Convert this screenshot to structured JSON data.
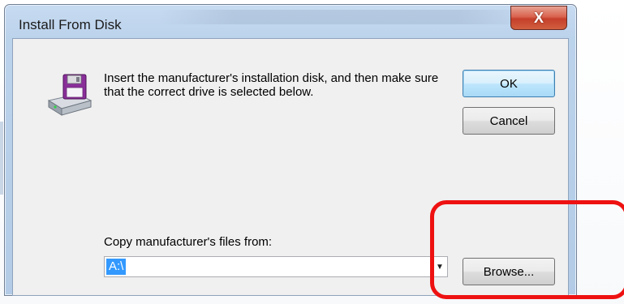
{
  "window": {
    "title": "Install From Disk",
    "close_label": "X"
  },
  "dialog": {
    "instructions": "Insert the manufacturer's installation disk, and then make sure that the correct drive is selected below.",
    "ok_label": "OK",
    "cancel_label": "Cancel",
    "copy_label": "Copy manufacturer's files from:",
    "path_value": "A:\\",
    "browse_label": "Browse...",
    "icon": "floppy-disk-drive-icon"
  },
  "colors": {
    "highlight": "#ee1111",
    "selection": "#3399ff",
    "close_button": "#c53f2a"
  }
}
